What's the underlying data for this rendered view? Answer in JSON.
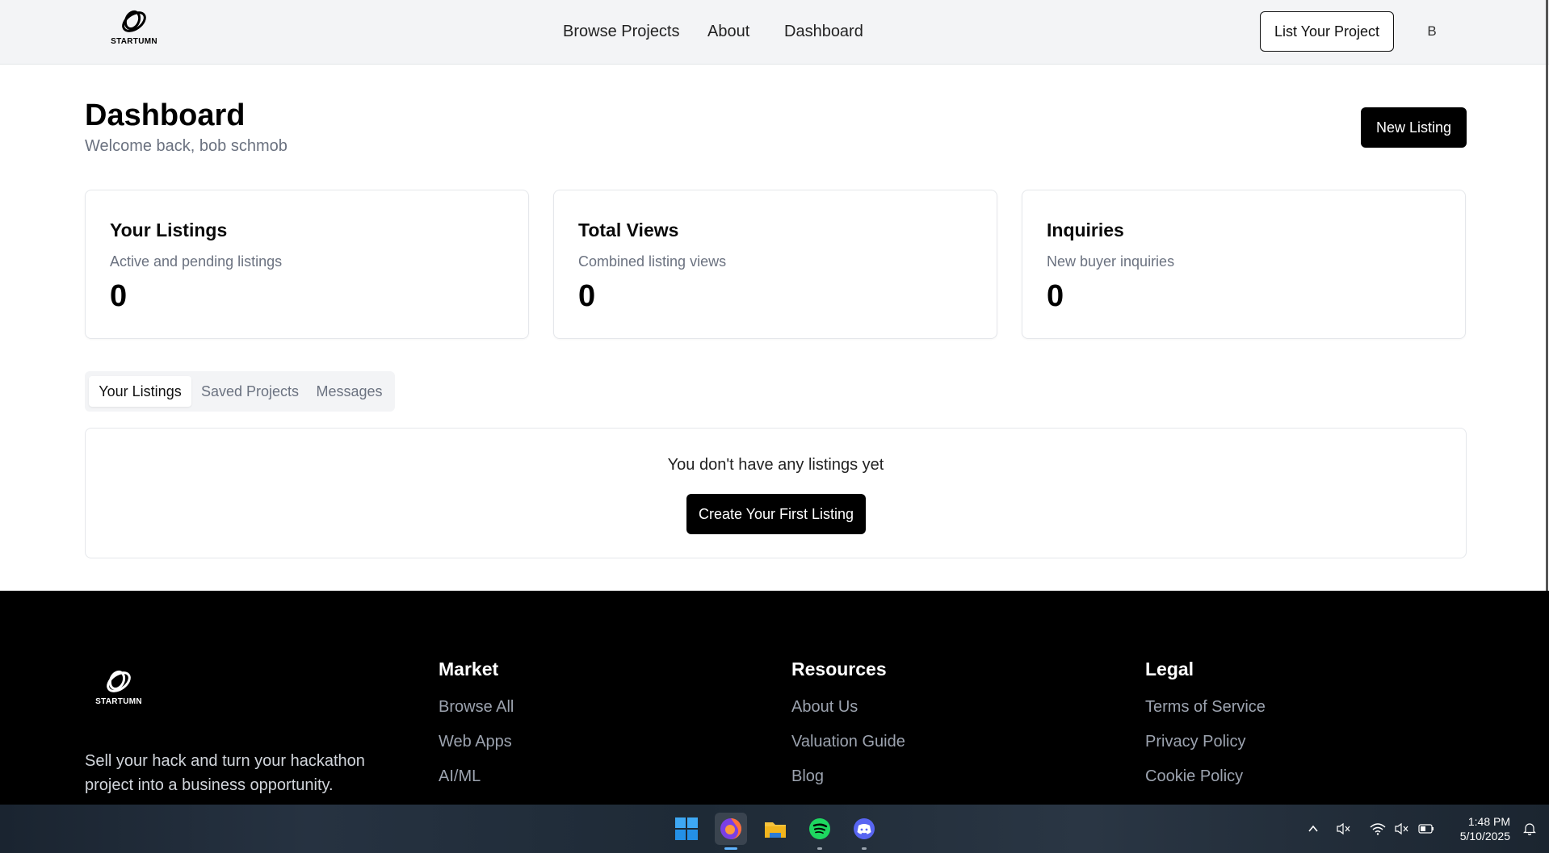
{
  "header": {
    "logo_text": "STARTUMN",
    "nav": [
      {
        "label": "Browse Projects"
      },
      {
        "label": "About"
      },
      {
        "label": "Dashboard"
      }
    ],
    "cta_label": "List Your Project",
    "avatar_initial": "B"
  },
  "page": {
    "title": "Dashboard",
    "subtitle": "Welcome back, bob schmob",
    "new_listing_label": "New Listing"
  },
  "stats": [
    {
      "title": "Your Listings",
      "desc": "Active and pending listings",
      "value": "0"
    },
    {
      "title": "Total Views",
      "desc": "Combined listing views",
      "value": "0"
    },
    {
      "title": "Inquiries",
      "desc": "New buyer inquiries",
      "value": "0"
    }
  ],
  "tabs": [
    {
      "label": "Your Listings",
      "active": true
    },
    {
      "label": "Saved Projects",
      "active": false
    },
    {
      "label": "Messages",
      "active": false
    }
  ],
  "listings": {
    "empty_text": "You don't have any listings yet",
    "create_label": "Create Your First Listing"
  },
  "footer": {
    "logo_text": "STARTUMN",
    "tagline": "Sell your hack and turn your hackathon project into a business opportunity.",
    "columns": [
      {
        "heading": "Market",
        "links": [
          "Browse All",
          "Web Apps",
          "AI/ML"
        ]
      },
      {
        "heading": "Resources",
        "links": [
          "About Us",
          "Valuation Guide",
          "Blog"
        ]
      },
      {
        "heading": "Legal",
        "links": [
          "Terms of Service",
          "Privacy Policy",
          "Cookie Policy"
        ]
      }
    ]
  },
  "taskbar": {
    "apps": [
      "windows-start-icon",
      "firefox-icon",
      "file-explorer-icon",
      "spotify-icon",
      "discord-icon"
    ],
    "time": "1:48 PM",
    "date": "5/10/2025"
  }
}
